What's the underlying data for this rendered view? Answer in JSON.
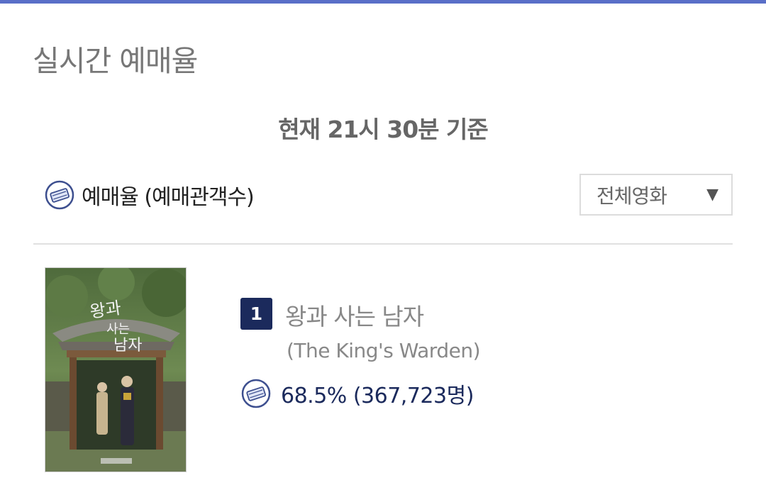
{
  "header": {
    "title": "실시간 예매율",
    "time_basis": "현재  21시 30분   기준"
  },
  "rate_section": {
    "icon": "ticket-icon",
    "label": "예매율 (예매관객수)"
  },
  "filter": {
    "selected": "전체영화",
    "arrow": "▼"
  },
  "movies": [
    {
      "rank": "1",
      "title": "왕과 사는 남자",
      "subtitle": "(The King's Warden)",
      "rate": "68.5% (367,723명)",
      "poster_icon": "movie-poster"
    }
  ],
  "colors": {
    "accent": "#5a6fc8",
    "navy": "#1b2a5c"
  }
}
